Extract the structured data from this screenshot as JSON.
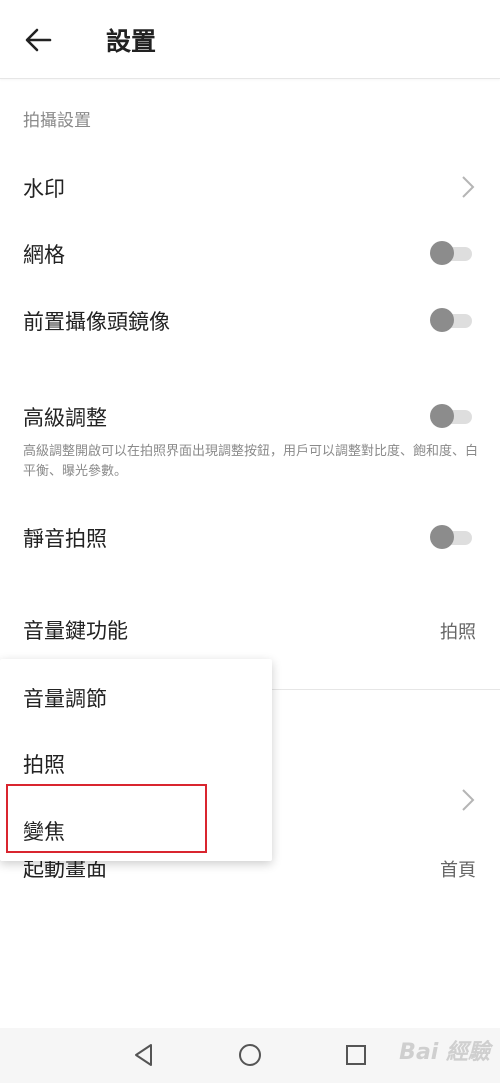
{
  "header": {
    "title": "設置",
    "back_icon": "arrow-left-icon"
  },
  "section": {
    "title": "拍攝設置"
  },
  "settings": {
    "watermark": {
      "label": "水印"
    },
    "grid": {
      "label": "網格",
      "enabled": false
    },
    "front_mirror": {
      "label": "前置攝像頭鏡像",
      "enabled": false
    },
    "advanced": {
      "label": "高級調整",
      "enabled": false,
      "description": "高級調整開啟可以在拍照界面出現調整按鈕，用戶可以調整對比度、飽和度、白平衡、曝光參數。"
    },
    "silent": {
      "label": "靜音拍照",
      "enabled": false
    },
    "volume_key": {
      "label": "音量鍵功能",
      "value": "拍照"
    },
    "startup": {
      "label": "起動畫面",
      "value": "首頁"
    }
  },
  "popup_menu": {
    "items": [
      {
        "label": "音量調節"
      },
      {
        "label": "拍照"
      },
      {
        "label": "變焦"
      }
    ],
    "highlighted_item": "變焦",
    "highlight_color": "#d9252f"
  },
  "navbar": {
    "icons": [
      "back-triangle-icon",
      "home-circle-icon",
      "recents-square-icon"
    ]
  },
  "watermark_text": "Bai 經驗",
  "colors": {
    "toggle_thumb": "#8c8c8c",
    "toggle_track": "#dedede",
    "secondary_text": "#8a8a8a"
  }
}
